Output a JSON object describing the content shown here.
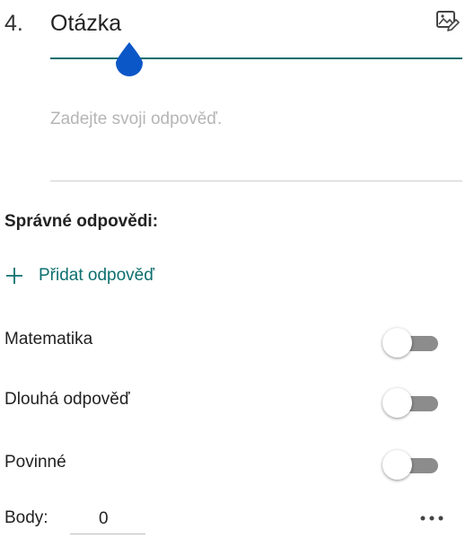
{
  "question": {
    "number": "4.",
    "title": "Otázka",
    "answer_placeholder": "Zadejte svoji odpověď.",
    "accent_color": "#0e6e6e",
    "edit_icon": "image-edit-icon"
  },
  "correct_answers": {
    "label": "Správné odpovědi:",
    "add_label": "Přidat odpověď",
    "add_icon": "plus-icon"
  },
  "options": [
    {
      "label": "Matematika",
      "enabled": false
    },
    {
      "label": "Dlouhá odpověď",
      "enabled": false
    },
    {
      "label": "Povinné",
      "enabled": false
    }
  ],
  "points": {
    "label": "Body:",
    "value": "0"
  },
  "more_icon": "more-horizontal-icon"
}
